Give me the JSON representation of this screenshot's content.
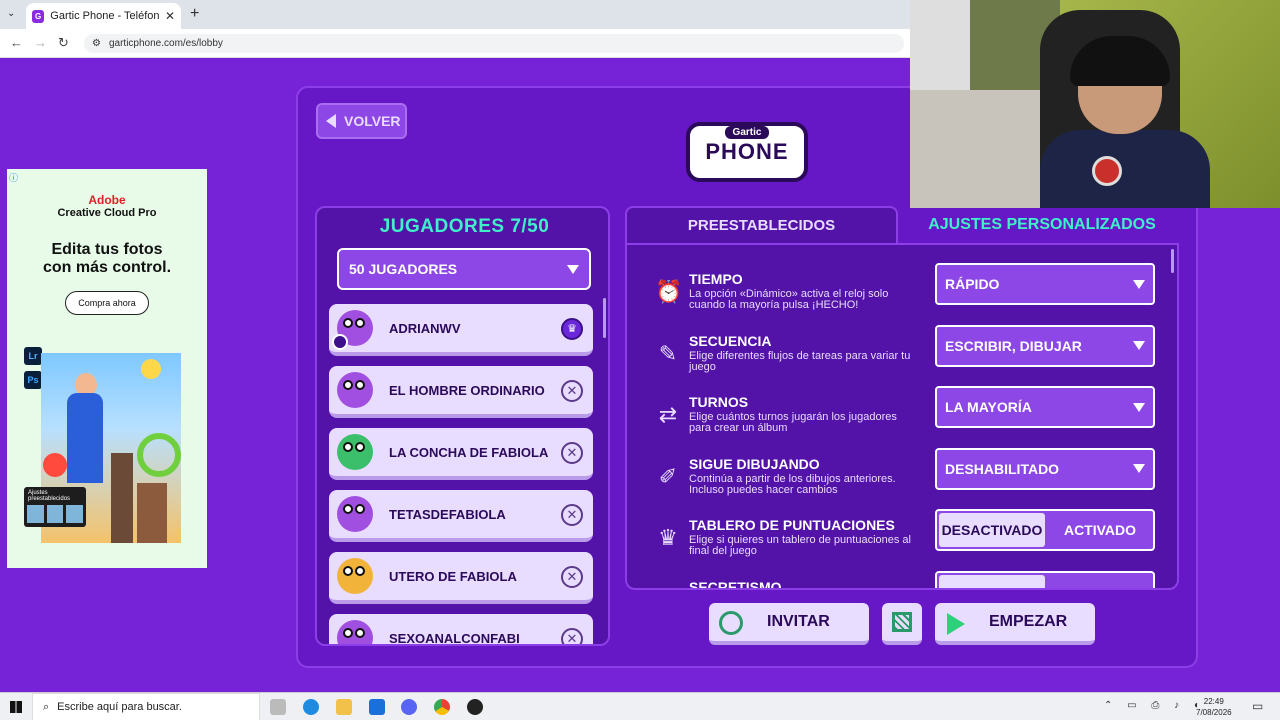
{
  "browser": {
    "tab_title": "Gartic Phone - Teléfono Descompuesto",
    "url": "garticphone.com/es/lobby"
  },
  "ad": {
    "brand": "Adobe",
    "product": "Creative Cloud Pro",
    "headline_1": "Edita tus fotos",
    "headline_2": "con más control.",
    "cta": "Compra ahora",
    "thumb_label": "Ajustes preestablecidos",
    "app_icons": [
      "Lr",
      "Ps"
    ]
  },
  "header": {
    "back_label": "VOLVER",
    "logo_small": "Gartic",
    "logo_big": "PHONE"
  },
  "players": {
    "title": "JUGADORES 7/50",
    "limit_select": "50 JUGADORES",
    "list": [
      {
        "name": "ADRIANWV",
        "action": "crown-icon",
        "avatar_color": "#a14fe0"
      },
      {
        "name": "EL HOMBRE ORDINARIO",
        "action": "remove-icon",
        "avatar_color": "#a14fe0"
      },
      {
        "name": "LA CONCHA DE FABIOLA",
        "action": "remove-icon",
        "avatar_color": "#3bbf6a"
      },
      {
        "name": "TETASDEFABIOLA",
        "action": "remove-icon",
        "avatar_color": "#a14fe0"
      },
      {
        "name": "UTERO DE FABIOLA",
        "action": "remove-icon",
        "avatar_color": "#f2b33a"
      },
      {
        "name": "SEXOANALCONFABI",
        "action": "remove-icon",
        "avatar_color": "#a14fe0"
      }
    ]
  },
  "settings_tabs": {
    "presets": "PREESTABLECIDOS",
    "custom": "AJUSTES PERSONALIZADOS"
  },
  "settings": [
    {
      "name": "TIEMPO",
      "desc": "La opción «Dinámico» activa el reloj solo cuando la mayoría pulsa ¡HECHO!",
      "value": "RÁPIDO",
      "icon": "alarm-clock-icon"
    },
    {
      "name": "SECUENCIA",
      "desc": "Elige diferentes flujos de tareas para variar tu juego",
      "value": "ESCRIBIR, DIBUJAR",
      "icon": "pen-bubble-icon"
    },
    {
      "name": "TURNOS",
      "desc": "Elige cuántos turnos jugarán los jugadores para crear un álbum",
      "value": "LA MAYORÍA",
      "icon": "turns-icon"
    },
    {
      "name": "SIGUE DIBUJANDO",
      "desc": "Continúa a partir de los dibujos anteriores. Incluso puedes hacer cambios",
      "value": "DESHABILITADO",
      "icon": "sketch-icon"
    },
    {
      "name": "TABLERO DE PUNTUACIONES",
      "desc": "Elige si quieres un tablero de puntuaciones al final del juego",
      "toggle_off": "DESACTIVADO",
      "toggle_on": "ACTIVADO",
      "icon": "trophy-icon"
    },
    {
      "name": "SECRETISMO",
      "desc": "",
      "icon": "secret-icon"
    }
  ],
  "actions": {
    "invite": "INVITAR",
    "start": "EMPEZAR"
  },
  "taskbar": {
    "search_placeholder": "Escribe aquí para buscar.",
    "time": "22:49",
    "date": "7/08/2026"
  }
}
